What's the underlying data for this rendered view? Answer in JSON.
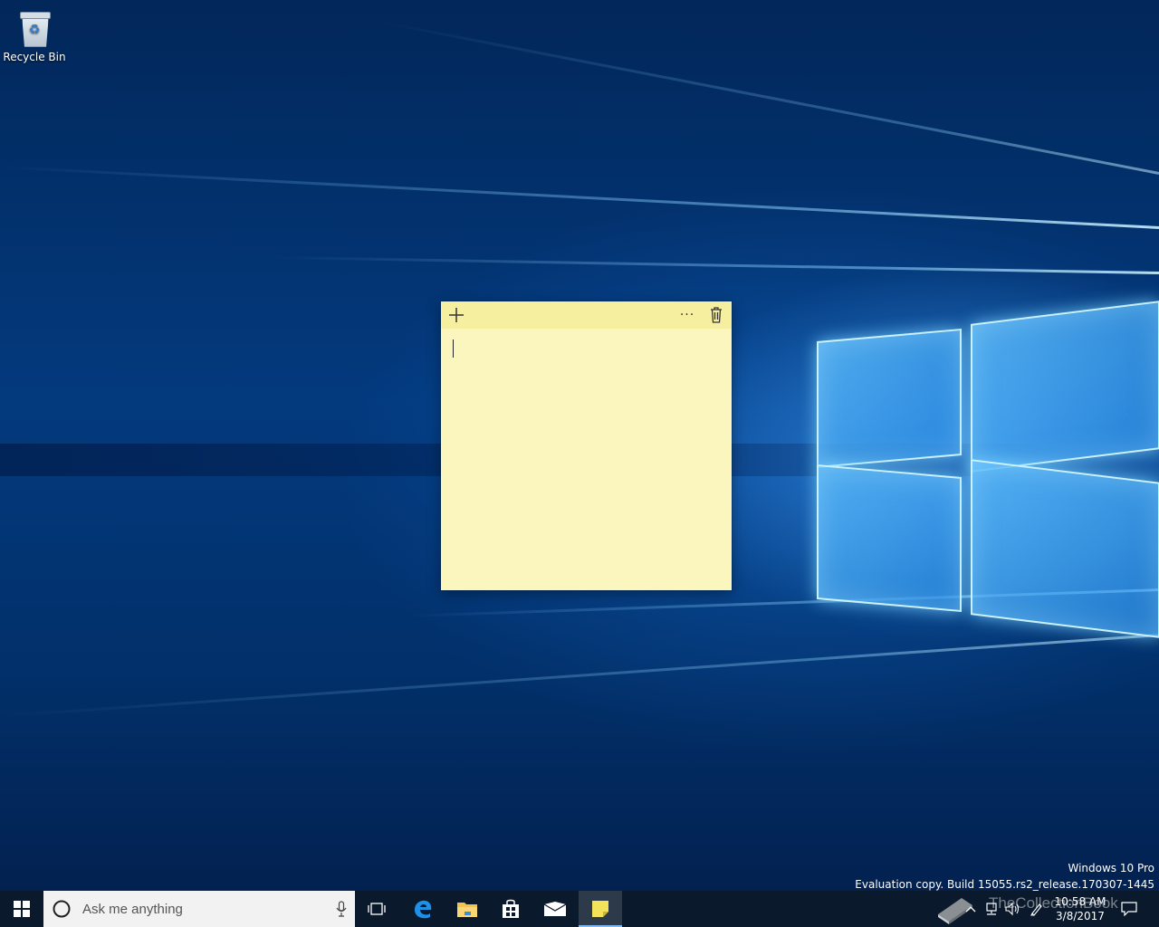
{
  "desktop": {
    "icons": [
      {
        "label": "Recycle Bin",
        "icon": "recycle-bin-icon"
      }
    ],
    "watermark_line1": "Windows 10 Pro",
    "watermark_line2": "Evaluation copy. Build 15055.rs2_release.170307-1445"
  },
  "sticky_note": {
    "icons": {
      "add": "plus-icon",
      "menu": "more-icon",
      "delete": "trash-icon"
    },
    "menu_label": "···",
    "content": "",
    "color": "#fbf6bd",
    "header_color": "#f7efa0"
  },
  "taskbar": {
    "search_placeholder": "Ask me anything",
    "apps": [
      {
        "name": "Task View",
        "icon": "task-view-icon"
      },
      {
        "name": "Microsoft Edge",
        "icon": "edge-icon"
      },
      {
        "name": "File Explorer",
        "icon": "folder-icon"
      },
      {
        "name": "Store",
        "icon": "store-icon"
      },
      {
        "name": "Mail",
        "icon": "mail-icon"
      },
      {
        "name": "Sticky Notes",
        "icon": "sticky-notes-icon",
        "active": true
      }
    ],
    "tray": {
      "time": "10:58 AM",
      "date": "3/8/2017",
      "overlay_text": "TheCollectionBook"
    }
  }
}
